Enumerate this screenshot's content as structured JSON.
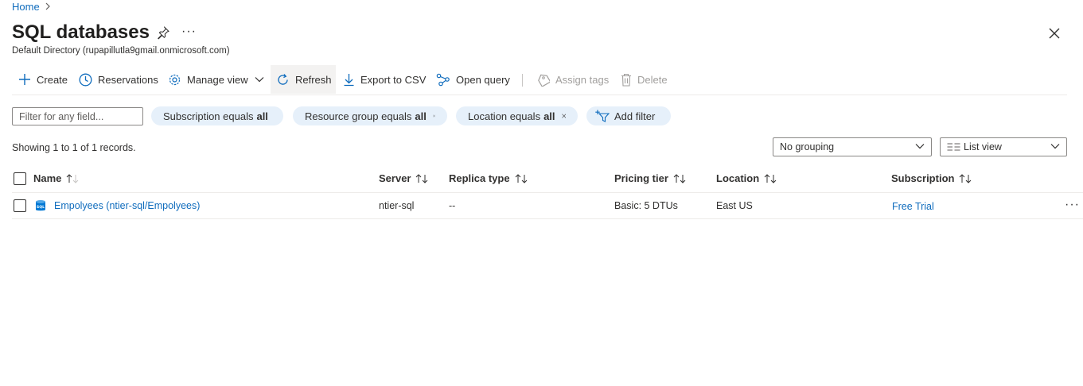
{
  "breadcrumb": {
    "home": "Home"
  },
  "header": {
    "title": "SQL databases",
    "subtitle": "Default Directory (rupapillutla9gmail.onmicrosoft.com)",
    "more": "···"
  },
  "toolbar": {
    "create": "Create",
    "reservations": "Reservations",
    "manage_view": "Manage view",
    "refresh": "Refresh",
    "export_csv": "Export to CSV",
    "open_query": "Open query",
    "assign_tags": "Assign tags",
    "delete": "Delete"
  },
  "filters": {
    "placeholder": "Filter for any field...",
    "subscription": {
      "label": "Subscription equals",
      "value": "all"
    },
    "resource_group": {
      "label": "Resource group equals",
      "value": "all"
    },
    "location": {
      "label": "Location equals",
      "value": "all"
    },
    "add_filter": "Add filter"
  },
  "records": "Showing 1 to 1 of 1 records.",
  "grouping": {
    "selected": "No grouping"
  },
  "view": {
    "selected": "List view"
  },
  "table": {
    "columns": [
      "Name",
      "Server",
      "Replica type",
      "Pricing tier",
      "Location",
      "Subscription"
    ],
    "rows": [
      {
        "name": "Empolyees (ntier-sql/Empolyees)",
        "server": "ntier-sql",
        "replica_type": "--",
        "pricing_tier": "Basic: 5 DTUs",
        "location": "East US",
        "subscription": "Free Trial",
        "more": "···"
      }
    ]
  },
  "colors": {
    "link": "#0f6cbd",
    "pill_bg": "#e6f0fa",
    "text": "#323130",
    "disabled": "#a19f9d"
  }
}
